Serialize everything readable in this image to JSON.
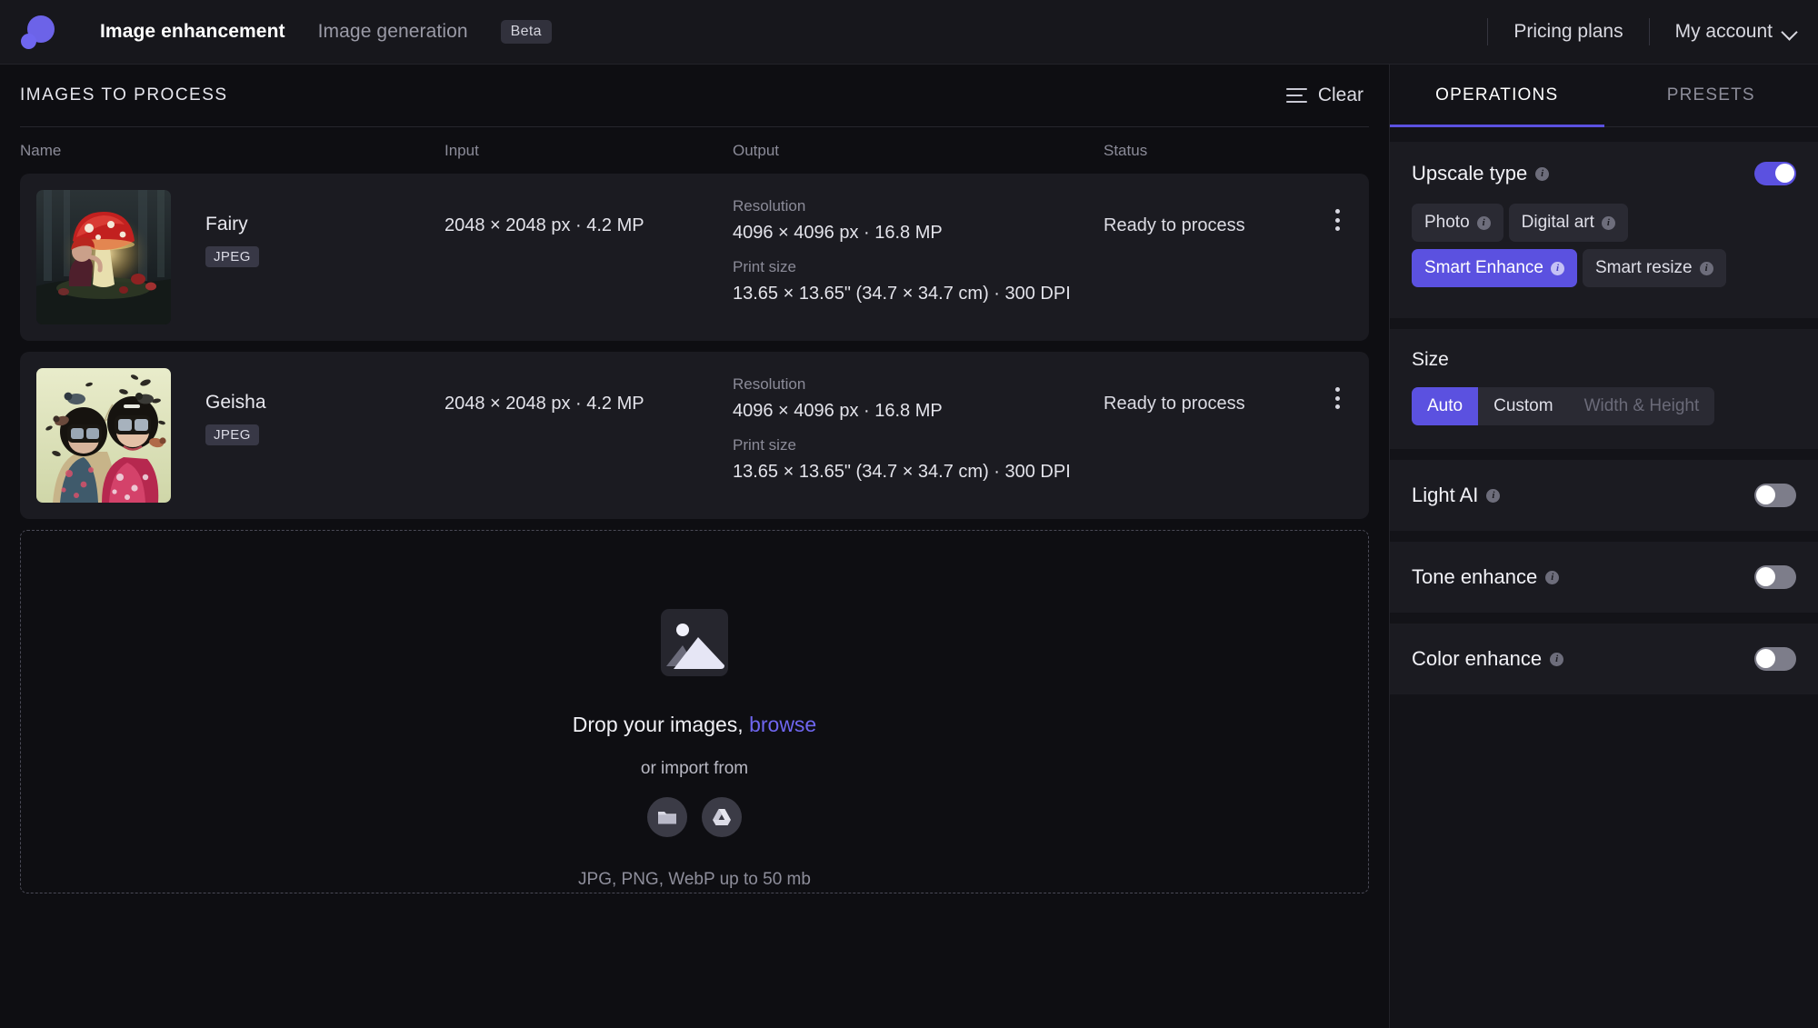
{
  "header": {
    "logo_name": "logo-icon",
    "nav": [
      {
        "label": "Image enhancement",
        "active": true
      },
      {
        "label": "Image generation",
        "active": false
      }
    ],
    "beta_badge": "Beta",
    "pricing_link": "Pricing plans",
    "account_link": "My account"
  },
  "left": {
    "section_title": "IMAGES TO PROCESS",
    "clear_label": "Clear",
    "columns": {
      "name": "Name",
      "input": "Input",
      "output": "Output",
      "status": "Status"
    },
    "out_labels": {
      "resolution": "Resolution",
      "print_size": "Print size"
    },
    "rows": [
      {
        "name": "Fairy",
        "format": "JPEG",
        "input": "2048 × 2048 px · 4.2 MP",
        "resolution": "4096 × 4096 px · 16.8 MP",
        "print_size": "13.65 × 13.65\" (34.7 × 34.7 cm) · 300 DPI",
        "status": "Ready to process",
        "thumb": "fairy-mushroom-thumbnail"
      },
      {
        "name": "Geisha",
        "format": "JPEG",
        "input": "2048 × 2048 px · 4.2 MP",
        "resolution": "4096 × 4096 px · 16.8 MP",
        "print_size": "13.65 × 13.65\" (34.7 × 34.7 cm) · 300 DPI",
        "status": "Ready to process",
        "thumb": "geisha-vr-thumbnail"
      }
    ],
    "dropzone": {
      "icon": "image-placeholder-icon",
      "line1_prefix": "Drop your images, ",
      "browse": "browse",
      "line2": "or import from",
      "imports": [
        {
          "name": "folder-icon"
        },
        {
          "name": "google-drive-icon"
        }
      ],
      "note": "JPG, PNG, WebP up to 50 mb"
    }
  },
  "right": {
    "tabs": [
      {
        "label": "OPERATIONS",
        "active": true
      },
      {
        "label": "PRESETS",
        "active": false
      }
    ],
    "upscale": {
      "title": "Upscale type",
      "enabled": true,
      "chips_row1": [
        {
          "label": "Photo",
          "selected": false
        },
        {
          "label": "Digital art",
          "selected": false
        }
      ],
      "chips_row2": [
        {
          "label": "Smart Enhance",
          "selected": true
        },
        {
          "label": "Smart resize",
          "selected": false
        }
      ]
    },
    "size": {
      "title": "Size",
      "options": [
        {
          "label": "Auto",
          "selected": true,
          "disabled": false
        },
        {
          "label": "Custom",
          "selected": false,
          "disabled": false
        },
        {
          "label": "Width & Height",
          "selected": false,
          "disabled": true
        }
      ]
    },
    "toggles": [
      {
        "title": "Light AI",
        "enabled": false
      },
      {
        "title": "Tone enhance",
        "enabled": false
      },
      {
        "title": "Color enhance",
        "enabled": false
      }
    ]
  },
  "colors": {
    "accent": "#5b51e0",
    "accent_link": "#6f66f0",
    "page_bg": "#0e0e12",
    "card_bg": "#1b1b21",
    "header_bg": "#17171c"
  }
}
